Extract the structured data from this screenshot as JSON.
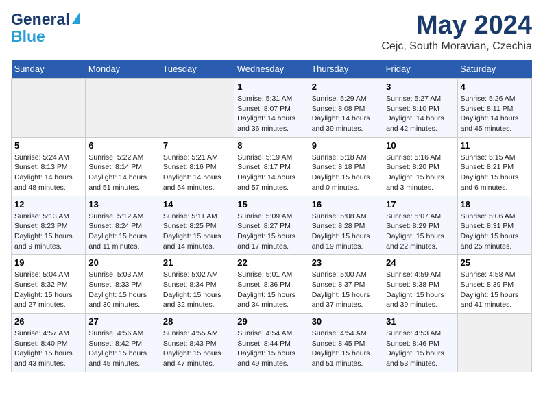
{
  "header": {
    "logo_line1": "General",
    "logo_line2": "Blue",
    "month": "May 2024",
    "location": "Cejc, South Moravian, Czechia"
  },
  "calendar": {
    "days_of_week": [
      "Sunday",
      "Monday",
      "Tuesday",
      "Wednesday",
      "Thursday",
      "Friday",
      "Saturday"
    ],
    "weeks": [
      [
        {
          "day": "",
          "content": ""
        },
        {
          "day": "",
          "content": ""
        },
        {
          "day": "",
          "content": ""
        },
        {
          "day": "1",
          "content": "Sunrise: 5:31 AM\nSunset: 8:07 PM\nDaylight: 14 hours\nand 36 minutes."
        },
        {
          "day": "2",
          "content": "Sunrise: 5:29 AM\nSunset: 8:08 PM\nDaylight: 14 hours\nand 39 minutes."
        },
        {
          "day": "3",
          "content": "Sunrise: 5:27 AM\nSunset: 8:10 PM\nDaylight: 14 hours\nand 42 minutes."
        },
        {
          "day": "4",
          "content": "Sunrise: 5:26 AM\nSunset: 8:11 PM\nDaylight: 14 hours\nand 45 minutes."
        }
      ],
      [
        {
          "day": "5",
          "content": "Sunrise: 5:24 AM\nSunset: 8:13 PM\nDaylight: 14 hours\nand 48 minutes."
        },
        {
          "day": "6",
          "content": "Sunrise: 5:22 AM\nSunset: 8:14 PM\nDaylight: 14 hours\nand 51 minutes."
        },
        {
          "day": "7",
          "content": "Sunrise: 5:21 AM\nSunset: 8:16 PM\nDaylight: 14 hours\nand 54 minutes."
        },
        {
          "day": "8",
          "content": "Sunrise: 5:19 AM\nSunset: 8:17 PM\nDaylight: 14 hours\nand 57 minutes."
        },
        {
          "day": "9",
          "content": "Sunrise: 5:18 AM\nSunset: 8:18 PM\nDaylight: 15 hours\nand 0 minutes."
        },
        {
          "day": "10",
          "content": "Sunrise: 5:16 AM\nSunset: 8:20 PM\nDaylight: 15 hours\nand 3 minutes."
        },
        {
          "day": "11",
          "content": "Sunrise: 5:15 AM\nSunset: 8:21 PM\nDaylight: 15 hours\nand 6 minutes."
        }
      ],
      [
        {
          "day": "12",
          "content": "Sunrise: 5:13 AM\nSunset: 8:23 PM\nDaylight: 15 hours\nand 9 minutes."
        },
        {
          "day": "13",
          "content": "Sunrise: 5:12 AM\nSunset: 8:24 PM\nDaylight: 15 hours\nand 11 minutes."
        },
        {
          "day": "14",
          "content": "Sunrise: 5:11 AM\nSunset: 8:25 PM\nDaylight: 15 hours\nand 14 minutes."
        },
        {
          "day": "15",
          "content": "Sunrise: 5:09 AM\nSunset: 8:27 PM\nDaylight: 15 hours\nand 17 minutes."
        },
        {
          "day": "16",
          "content": "Sunrise: 5:08 AM\nSunset: 8:28 PM\nDaylight: 15 hours\nand 19 minutes."
        },
        {
          "day": "17",
          "content": "Sunrise: 5:07 AM\nSunset: 8:29 PM\nDaylight: 15 hours\nand 22 minutes."
        },
        {
          "day": "18",
          "content": "Sunrise: 5:06 AM\nSunset: 8:31 PM\nDaylight: 15 hours\nand 25 minutes."
        }
      ],
      [
        {
          "day": "19",
          "content": "Sunrise: 5:04 AM\nSunset: 8:32 PM\nDaylight: 15 hours\nand 27 minutes."
        },
        {
          "day": "20",
          "content": "Sunrise: 5:03 AM\nSunset: 8:33 PM\nDaylight: 15 hours\nand 30 minutes."
        },
        {
          "day": "21",
          "content": "Sunrise: 5:02 AM\nSunset: 8:34 PM\nDaylight: 15 hours\nand 32 minutes."
        },
        {
          "day": "22",
          "content": "Sunrise: 5:01 AM\nSunset: 8:36 PM\nDaylight: 15 hours\nand 34 minutes."
        },
        {
          "day": "23",
          "content": "Sunrise: 5:00 AM\nSunset: 8:37 PM\nDaylight: 15 hours\nand 37 minutes."
        },
        {
          "day": "24",
          "content": "Sunrise: 4:59 AM\nSunset: 8:38 PM\nDaylight: 15 hours\nand 39 minutes."
        },
        {
          "day": "25",
          "content": "Sunrise: 4:58 AM\nSunset: 8:39 PM\nDaylight: 15 hours\nand 41 minutes."
        }
      ],
      [
        {
          "day": "26",
          "content": "Sunrise: 4:57 AM\nSunset: 8:40 PM\nDaylight: 15 hours\nand 43 minutes."
        },
        {
          "day": "27",
          "content": "Sunrise: 4:56 AM\nSunset: 8:42 PM\nDaylight: 15 hours\nand 45 minutes."
        },
        {
          "day": "28",
          "content": "Sunrise: 4:55 AM\nSunset: 8:43 PM\nDaylight: 15 hours\nand 47 minutes."
        },
        {
          "day": "29",
          "content": "Sunrise: 4:54 AM\nSunset: 8:44 PM\nDaylight: 15 hours\nand 49 minutes."
        },
        {
          "day": "30",
          "content": "Sunrise: 4:54 AM\nSunset: 8:45 PM\nDaylight: 15 hours\nand 51 minutes."
        },
        {
          "day": "31",
          "content": "Sunrise: 4:53 AM\nSunset: 8:46 PM\nDaylight: 15 hours\nand 53 minutes."
        },
        {
          "day": "",
          "content": ""
        }
      ]
    ]
  }
}
